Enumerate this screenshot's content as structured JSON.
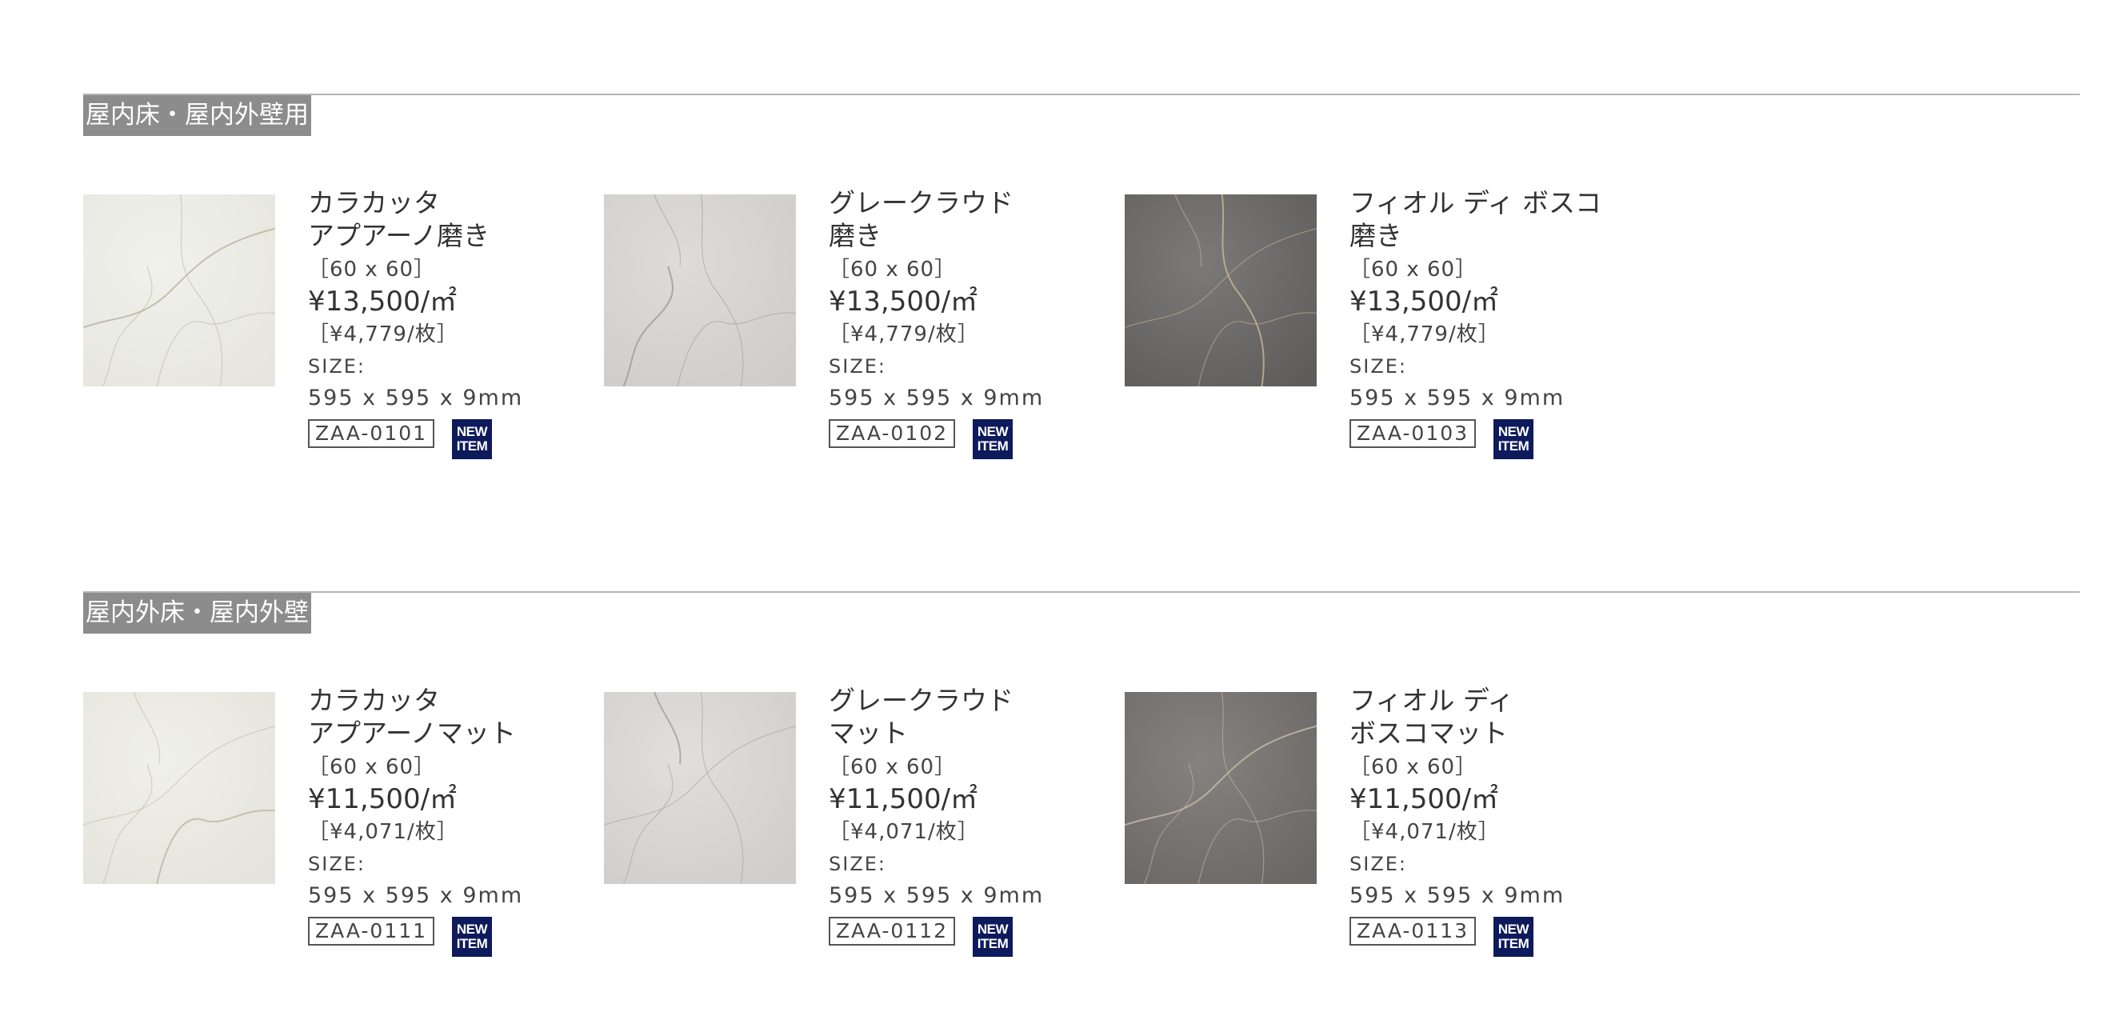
{
  "sections": [
    {
      "label": "屋内床・屋内外壁用",
      "products": [
        {
          "name_line1": "カラカッタ",
          "name_line2": "アプアーノ磨き",
          "dims": "［60 x 60］",
          "price": "¥13,500/㎡",
          "per_piece": "［¥4,779/枚］",
          "size_label": "SIZE:",
          "size_value": "595 x 595 x 9mm",
          "code": "ZAA-0101",
          "badge_line1": "NEW",
          "badge_line2": "ITEM",
          "swatch_colors": [
            "#f1f1ec",
            "#e6e6df",
            "#b8b49a"
          ]
        },
        {
          "name_line1": "グレークラウド",
          "name_line2": "磨き",
          "dims": "［60 x 60］",
          "price": "¥13,500/㎡",
          "per_piece": "［¥4,779/枚］",
          "size_label": "SIZE:",
          "size_value": "595 x 595 x 9mm",
          "code": "ZAA-0102",
          "badge_line1": "NEW",
          "badge_line2": "ITEM",
          "swatch_colors": [
            "#dddcdb",
            "#cfcdcb",
            "#9e9a97"
          ]
        },
        {
          "name_line1": "フィオル ディ ボスコ",
          "name_line2": "磨き",
          "dims": "［60 x 60］",
          "price": "¥13,500/㎡",
          "per_piece": "［¥4,779/枚］",
          "size_label": "SIZE:",
          "size_value": "595 x 595 x 9mm",
          "code": "ZAA-0103",
          "badge_line1": "NEW",
          "badge_line2": "ITEM",
          "swatch_colors": [
            "#7c7a78",
            "#5f5d5b",
            "#c9b79a"
          ]
        }
      ]
    },
    {
      "label": "屋内外床・屋内外壁",
      "products": [
        {
          "name_line1": "カラカッタ",
          "name_line2": "アプアーノマット",
          "dims": "［60 x 60］",
          "price": "¥11,500/㎡",
          "per_piece": "［¥4,071/枚］",
          "size_label": "SIZE:",
          "size_value": "595 x 595 x 9mm",
          "code": "ZAA-0111",
          "badge_line1": "NEW",
          "badge_line2": "ITEM",
          "swatch_colors": [
            "#f0f0ea",
            "#e4e3dc",
            "#bdb79f"
          ]
        },
        {
          "name_line1": "グレークラウド",
          "name_line2": "マット",
          "dims": "［60 x 60］",
          "price": "¥11,500/㎡",
          "per_piece": "［¥4,071/枚］",
          "size_label": "SIZE:",
          "size_value": "595 x 595 x 9mm",
          "code": "ZAA-0112",
          "badge_line1": "NEW",
          "badge_line2": "ITEM",
          "swatch_colors": [
            "#e0dfde",
            "#d0cecc",
            "#a29e9a"
          ]
        },
        {
          "name_line1": "フィオル ディ",
          "name_line2": "ボスコマット",
          "dims": "［60 x 60］",
          "price": "¥11,500/㎡",
          "per_piece": "［¥4,071/枚］",
          "size_label": "SIZE:",
          "size_value": "595 x 595 x 9mm",
          "code": "ZAA-0113",
          "badge_line1": "NEW",
          "badge_line2": "ITEM",
          "swatch_colors": [
            "#858280",
            "#6a6765",
            "#c8bba8"
          ]
        }
      ]
    }
  ],
  "colors": {
    "section_label_bg": "#8c8c8c",
    "rule": "#b4b4b4",
    "badge_bg": "#0d1a5c"
  }
}
